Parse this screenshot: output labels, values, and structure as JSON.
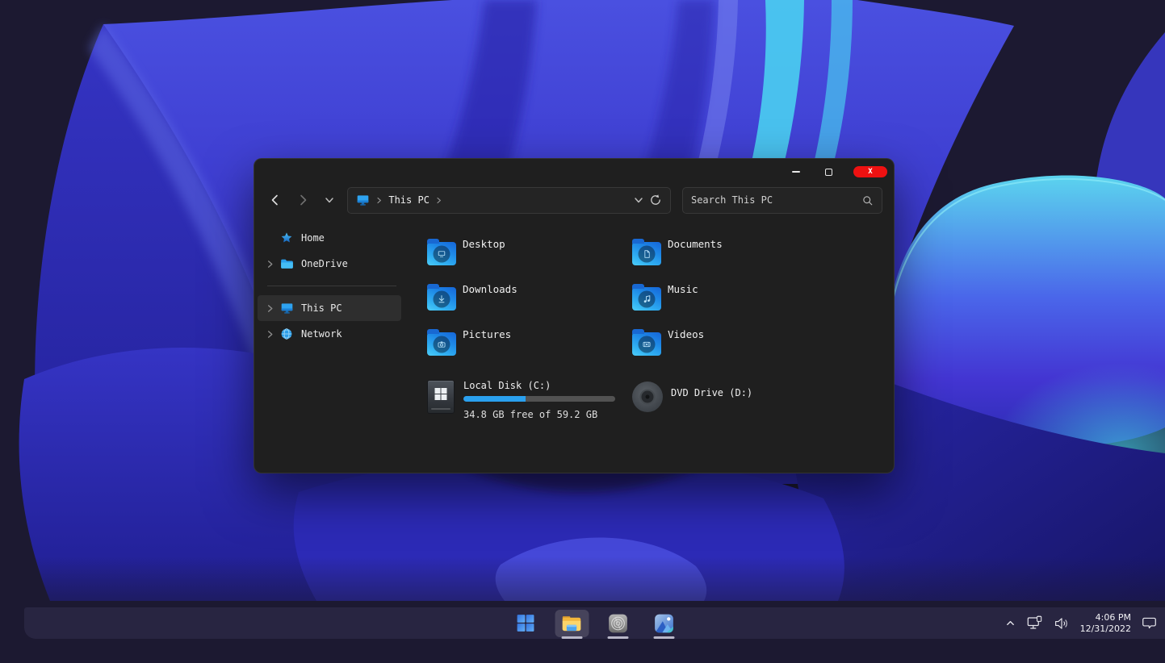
{
  "window": {
    "close_glyph": "X",
    "address": {
      "location": "This PC",
      "device_icon": "monitor-icon"
    },
    "search": {
      "placeholder": "Search This PC",
      "icon": "magnifier-icon"
    },
    "toolbar_icons": [
      "back-arrow-icon",
      "forward-arrow-icon",
      "chevron-down-icon",
      "refresh-icon"
    ]
  },
  "sidebar": {
    "items": [
      {
        "label": "Home",
        "icon": "star-icon",
        "selected": false,
        "expandable": false
      },
      {
        "label": "OneDrive",
        "icon": "folder-icon",
        "selected": false,
        "expandable": true
      },
      {
        "label": "This PC",
        "icon": "monitor-icon",
        "selected": true,
        "expandable": true
      },
      {
        "label": "Network",
        "icon": "globe-icon",
        "selected": false,
        "expandable": true
      }
    ]
  },
  "folders": [
    {
      "label": "Desktop",
      "icon": "desktop-folder-icon"
    },
    {
      "label": "Documents",
      "icon": "documents-folder-icon"
    },
    {
      "label": "Downloads",
      "icon": "downloads-folder-icon"
    },
    {
      "label": "Music",
      "icon": "music-folder-icon"
    },
    {
      "label": "Pictures",
      "icon": "pictures-folder-icon"
    },
    {
      "label": "Videos",
      "icon": "videos-folder-icon"
    }
  ],
  "drives": {
    "local_disk": {
      "label": "Local Disk (C:)",
      "free_text": "34.8 GB free of 59.2 GB",
      "used_percent": 41
    },
    "dvd": {
      "label": "DVD Drive (D:)"
    }
  },
  "taskbar": {
    "icons": [
      "start-icon",
      "file-explorer-icon",
      "settings-icon",
      "photos-icon"
    ],
    "tray_icons": [
      "chevron-up-icon",
      "network-icon",
      "volume-icon",
      "notification-icon"
    ],
    "clock": {
      "time": "4:06 PM",
      "date": "12/31/2022"
    }
  },
  "colors": {
    "accent_blue": "#2aa0ee",
    "close_red": "#ee1111",
    "wallpaper_bg": "#1c1931",
    "window_bg": "#1f1f1f"
  }
}
